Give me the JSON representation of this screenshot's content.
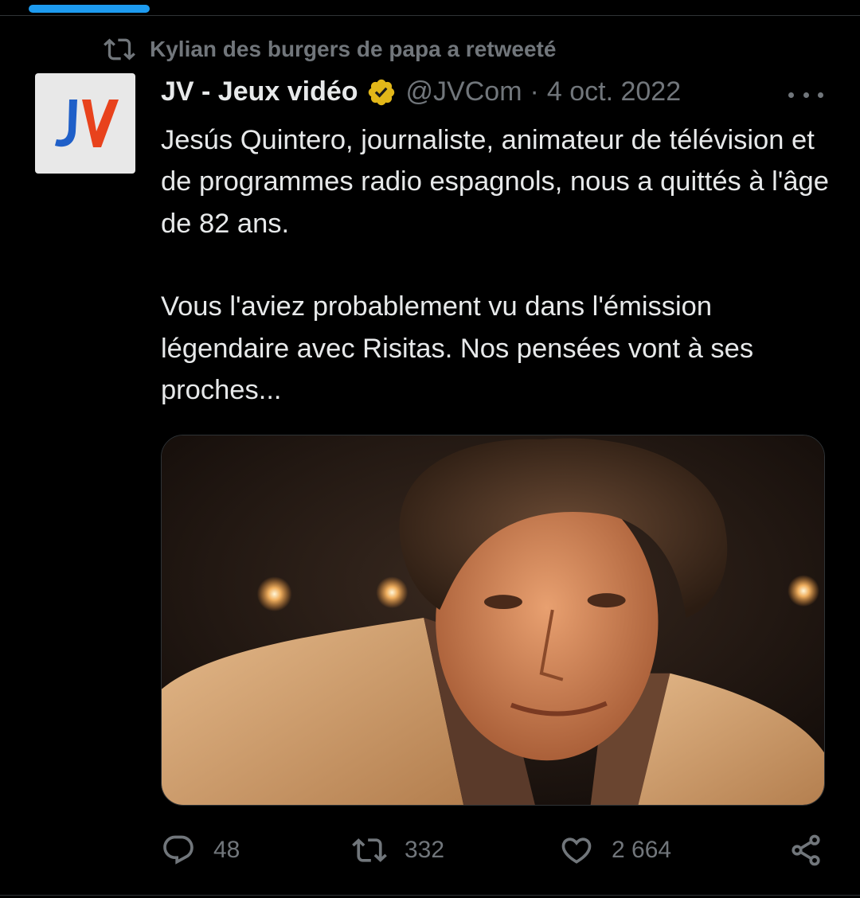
{
  "retweet": {
    "icon": "retweet-icon",
    "text": "Kylian des burgers de papa a retweeté"
  },
  "tweet": {
    "display_name": "JV - Jeux vidéo",
    "verified_badge": "gold-verified-icon",
    "handle": "@JVCom",
    "separator": "·",
    "date": "4 oct. 2022",
    "paragraphs": [
      "Jesús Quintero, journaliste, animateur de télévision et de programmes radio espagnols, nous a quittés à l'âge de 82 ans.",
      "Vous l'aviez probablement vu dans l'émission légendaire avec Risitas. Nos pensées vont à ses proches..."
    ],
    "avatar_logo_text": "JV",
    "media_alt": "Photo of Jesús Quintero"
  },
  "actions": {
    "replies": "48",
    "retweets": "332",
    "likes": "2 664"
  },
  "colors": {
    "background": "#000000",
    "text": "#e7e9ea",
    "muted": "#71767b",
    "accent": "#1d9bf0",
    "verified_gold": "#e2b719",
    "logo_blue": "#1f5fc8",
    "logo_red": "#e8421c"
  }
}
